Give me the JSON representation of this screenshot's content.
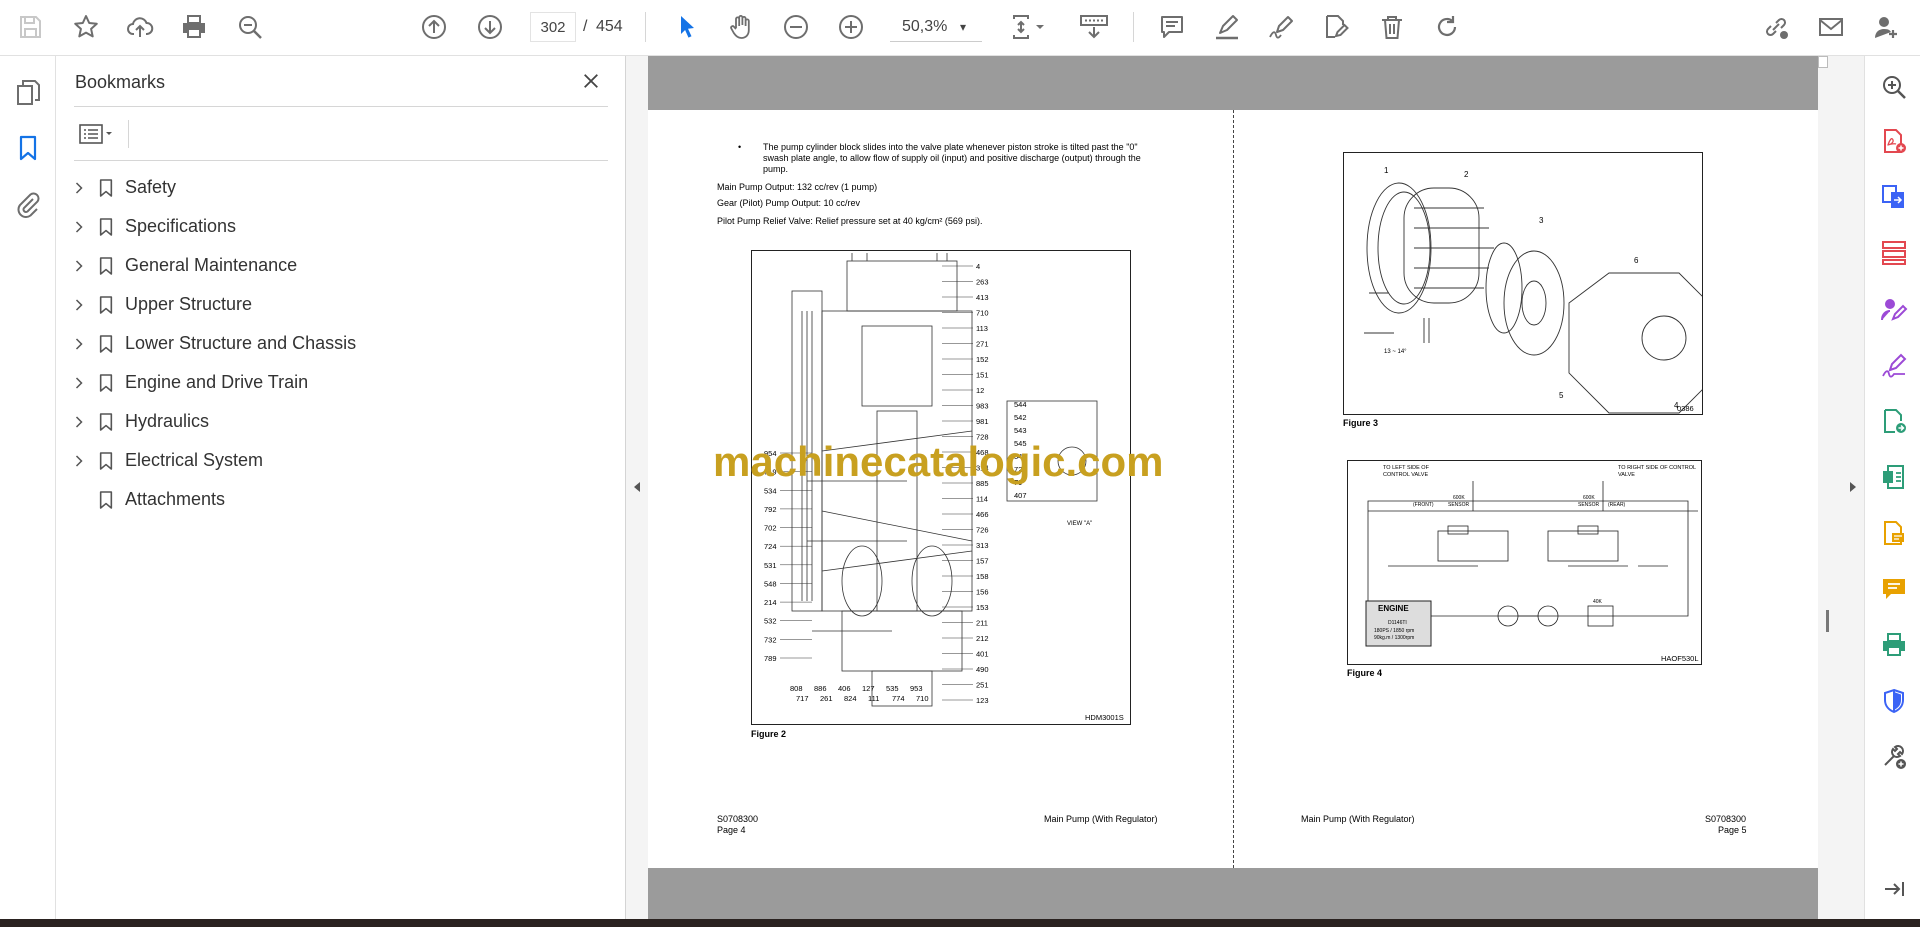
{
  "toolbar": {
    "page_current": "302",
    "page_separator": "/",
    "page_total": "454",
    "zoom": "50,3%",
    "zoom_caret": "▾"
  },
  "bookmarks": {
    "title": "Bookmarks",
    "items": [
      {
        "label": "Safety",
        "expandable": true
      },
      {
        "label": "Specifications",
        "expandable": true
      },
      {
        "label": "General Maintenance",
        "expandable": true
      },
      {
        "label": "Upper Structure",
        "expandable": true
      },
      {
        "label": "Lower Structure and Chassis",
        "expandable": true
      },
      {
        "label": "Engine and Drive Train",
        "expandable": true
      },
      {
        "label": "Hydraulics",
        "expandable": true
      },
      {
        "label": "Electrical System",
        "expandable": true
      },
      {
        "label": "Attachments",
        "expandable": false
      }
    ]
  },
  "document": {
    "left_page": {
      "bullet": "•",
      "bullet_text_1": "The pump cylinder block slides into the valve plate whenever piston stroke is tilted past the \"0\"",
      "bullet_text_2": "swash plate angle, to allow flow of supply oil (input) and positive discharge (output) through the",
      "bullet_text_3": "pump.",
      "line_main_pump": "Main Pump Output: 132 cc/rev (1 pump)",
      "line_gear_pump": "Gear (Pilot) Pump Output: 10 cc/rev",
      "line_relief": "Pilot Pump Relief Valve: Relief pressure set at 40 kg/cm² (569 psi).",
      "figure2_caption": "Figure 2",
      "figure2_code": "HDM3001S",
      "figure2_view": "VIEW \"A\"",
      "footer_code": "S0708300",
      "footer_page": "Page 4",
      "footer_title": "Main Pump (With Regulator)"
    },
    "right_page": {
      "figure3_caption": "Figure 3",
      "figure3_code": "0386",
      "figure3_angle": "13 ~ 14°",
      "figure4_caption": "Figure 4",
      "figure4_code": "HAOF530L",
      "figure4_left_label": "TO LEFT SIDE OF CONTROL VALVE",
      "figure4_right_label": "TO RIGHT SIDE OF CONTROL VALVE",
      "figure4_engine": "ENGINE",
      "figure4_engine_model": "D1146TI",
      "figure4_engine_spec1": "180PS / 1850 rpm",
      "figure4_engine_spec2": "90kg.m / 1300rpm",
      "figure4_front": "(FRONT)",
      "figure4_rear": "(REAR)",
      "figure4_sensor": "SENSOR",
      "figure4_600k": "600K",
      "figure4_40k": "40K",
      "footer_title": "Main Pump (With Regulator)",
      "footer_code": "S0708300",
      "footer_page": "Page 5"
    },
    "watermark": "machinecatalogic.com",
    "figure2_labels": {
      "right": [
        "4",
        "263",
        "413",
        "710",
        "113",
        "271",
        "152",
        "151",
        "12",
        "983",
        "981",
        "728",
        "468",
        "314",
        "885",
        "114",
        "466",
        "726",
        "313",
        "157",
        "158",
        "156",
        "153",
        "211",
        "212",
        "401",
        "490",
        "251",
        "123"
      ],
      "left": [
        "954",
        "719",
        "534",
        "792",
        "702",
        "724",
        "531",
        "548",
        "214",
        "532",
        "732",
        "789"
      ],
      "bottom": [
        "808",
        "886",
        "406",
        "127",
        "535",
        "953",
        "717",
        "261",
        "824",
        "111",
        "774",
        "710"
      ],
      "view_a": [
        "544",
        "542",
        "543",
        "545",
        "541",
        "725",
        "79",
        "407"
      ]
    },
    "figure3_labels": [
      "1",
      "2",
      "3",
      "4",
      "5",
      "6"
    ]
  },
  "colors": {
    "accent_blue": "#1473e6",
    "icon_gray": "#6e6e6e",
    "rail_red": "#e34850",
    "rail_purple": "#9c4ad6",
    "rail_green": "#2d9d78",
    "rail_yellow": "#e8a100",
    "rail_blue": "#3b63f5",
    "watermark": "#c8a020",
    "doc_bg": "#9b9b9b"
  }
}
